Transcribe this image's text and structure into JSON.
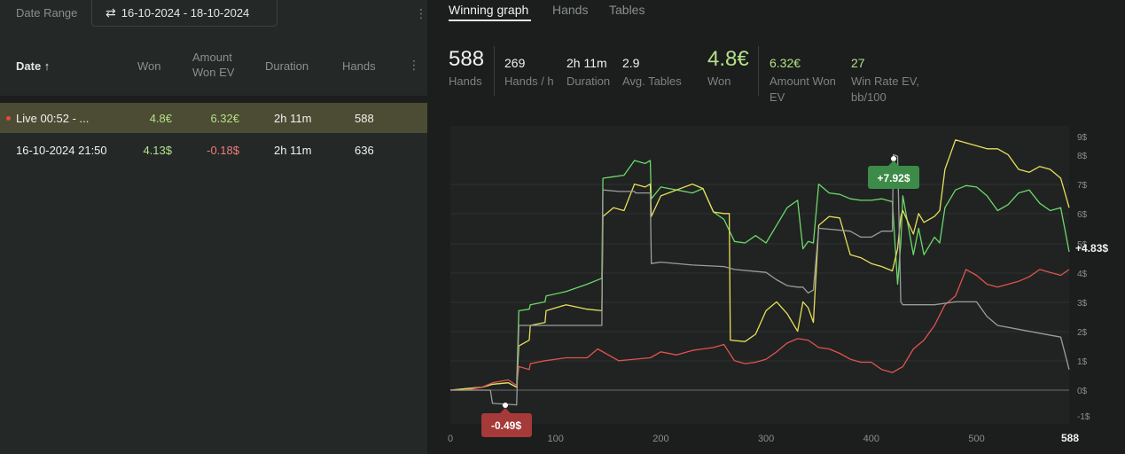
{
  "filter": {
    "date_range_label": "Date Range",
    "date_range_value": "16-10-2024 - 18-10-2024",
    "swap_icon": "⇄"
  },
  "table": {
    "headers": {
      "date": "Date ↑",
      "won": "Won",
      "ev_line1": "Amount",
      "ev_line2": "Won EV",
      "duration": "Duration",
      "hands": "Hands"
    },
    "rows": [
      {
        "date": "Live 00:52 - ...",
        "won": "4.8€",
        "ev": "6.32€",
        "duration": "2h 11m",
        "hands": "588",
        "live": true
      },
      {
        "date": "16-10-2024 21:50",
        "won": "4.13$",
        "ev": "-0.18$",
        "duration": "2h 11m",
        "hands": "636",
        "live": false
      }
    ]
  },
  "tabs": [
    "Winning graph",
    "Hands",
    "Tables"
  ],
  "stats": {
    "hands_value": "588",
    "hands_label": "Hands",
    "hph_value": "269",
    "hph_label": "Hands / h",
    "duration_value": "2h 11m",
    "duration_label": "Duration",
    "tables_value": "2.9",
    "tables_label": "Avg. Tables",
    "won_value": "4.8€",
    "won_label": "Won",
    "ev_value": "6.32€",
    "ev_label_1": "Amount Won",
    "ev_label_2": "EV",
    "winrate_value": "27",
    "winrate_label_1": "Win Rate EV,",
    "winrate_label_2": "bb/100"
  },
  "chart_data": {
    "type": "line",
    "x_ticks": [
      "0",
      "100",
      "200",
      "300",
      "400",
      "500"
    ],
    "x_max_label": "588",
    "xlim": [
      0,
      588
    ],
    "y_ticks": [
      "9$",
      "8$",
      "7$",
      "6$",
      "5$",
      "4$",
      "3$",
      "2$",
      "1$",
      "0$",
      "-1$"
    ],
    "ylim": [
      -1,
      9
    ],
    "annotations": {
      "max_label": "+7.92$",
      "min_label": "-0.49$",
      "end_label": "+4.83$"
    },
    "colors": {
      "green": "#6cd86a",
      "yellow": "#e8de5c",
      "red": "#e0534f",
      "gray": "#9a9d9b"
    },
    "series": [
      {
        "color": "green",
        "x": [
          0,
          15,
          30,
          40,
          55,
          63,
          65,
          75,
          76,
          90,
          91,
          110,
          130,
          144,
          145,
          155,
          165,
          175,
          185,
          190,
          191,
          200,
          215,
          230,
          240,
          250,
          260,
          270,
          280,
          290,
          300,
          310,
          320,
          330,
          335,
          340,
          345,
          350,
          360,
          370,
          380,
          390,
          400,
          410,
          420,
          425,
          428,
          430,
          440,
          445,
          450,
          460,
          465,
          470,
          480,
          490,
          500,
          510,
          520,
          530,
          540,
          550,
          560,
          570,
          580,
          588
        ],
        "y": [
          0.0,
          0.05,
          0.1,
          0.2,
          0.25,
          0.1,
          2.7,
          2.75,
          2.9,
          3.0,
          3.2,
          3.35,
          3.6,
          3.8,
          7.2,
          7.25,
          7.3,
          7.8,
          7.7,
          7.8,
          6.5,
          6.9,
          6.8,
          6.7,
          6.85,
          6.05,
          5.8,
          5.05,
          5.0,
          5.25,
          5.0,
          5.6,
          6.2,
          6.45,
          4.8,
          5.05,
          5.0,
          7.0,
          6.7,
          6.65,
          6.5,
          6.45,
          6.45,
          6.5,
          6.4,
          3.6,
          5.0,
          6.6,
          4.6,
          5.5,
          4.6,
          5.2,
          5.0,
          6.2,
          6.8,
          6.95,
          6.9,
          6.6,
          6.1,
          6.3,
          6.7,
          6.8,
          6.35,
          6.1,
          6.2,
          4.7
        ]
      },
      {
        "color": "yellow",
        "x": [
          0,
          15,
          30,
          40,
          55,
          63,
          65,
          75,
          76,
          90,
          91,
          110,
          130,
          144,
          145,
          155,
          165,
          175,
          185,
          190,
          191,
          200,
          215,
          230,
          240,
          250,
          260,
          265,
          266,
          280,
          290,
          300,
          310,
          320,
          330,
          335,
          340,
          345,
          350,
          360,
          370,
          380,
          390,
          400,
          410,
          420,
          425,
          428,
          430,
          440,
          445,
          450,
          460,
          465,
          470,
          480,
          490,
          500,
          510,
          520,
          530,
          540,
          550,
          560,
          570,
          580,
          588
        ],
        "y": [
          0.0,
          0.05,
          0.1,
          0.2,
          0.25,
          0.1,
          1.5,
          1.7,
          2.2,
          2.3,
          2.7,
          2.9,
          2.75,
          2.7,
          5.9,
          6.2,
          6.1,
          7.0,
          6.9,
          7.0,
          5.9,
          6.6,
          6.8,
          7.0,
          6.85,
          6.05,
          6.0,
          6.0,
          1.7,
          1.65,
          1.9,
          2.7,
          3.0,
          2.6,
          2.0,
          3.0,
          2.8,
          2.3,
          5.6,
          5.9,
          5.85,
          4.6,
          4.5,
          4.3,
          4.2,
          4.05,
          4.8,
          5.9,
          6.1,
          5.3,
          6.0,
          5.7,
          5.9,
          6.1,
          7.5,
          8.5,
          8.4,
          8.3,
          8.2,
          8.2,
          8.0,
          7.5,
          7.4,
          7.6,
          7.5,
          7.2,
          6.2
        ]
      },
      {
        "color": "red",
        "x": [
          0,
          15,
          30,
          40,
          55,
          63,
          65,
          75,
          76,
          90,
          110,
          130,
          140,
          160,
          175,
          190,
          200,
          215,
          230,
          240,
          250,
          260,
          270,
          280,
          290,
          300,
          310,
          320,
          330,
          340,
          350,
          360,
          370,
          380,
          390,
          400,
          410,
          420,
          430,
          440,
          450,
          460,
          470,
          480,
          490,
          500,
          510,
          520,
          530,
          540,
          550,
          560,
          570,
          580,
          588
        ],
        "y": [
          0.0,
          0.0,
          0.1,
          0.25,
          0.35,
          0.15,
          0.8,
          0.7,
          0.9,
          1.0,
          1.1,
          1.1,
          1.4,
          1.0,
          1.05,
          1.1,
          1.3,
          1.2,
          1.35,
          1.4,
          1.45,
          1.55,
          1.0,
          0.9,
          0.95,
          1.05,
          1.3,
          1.6,
          1.75,
          1.7,
          1.45,
          1.4,
          1.25,
          1.05,
          0.95,
          0.95,
          0.7,
          0.6,
          0.8,
          1.4,
          1.7,
          2.2,
          2.9,
          3.2,
          4.1,
          3.9,
          3.6,
          3.5,
          3.6,
          3.7,
          3.85,
          4.1,
          4.0,
          3.9,
          4.1
        ]
      },
      {
        "color": "gray",
        "x": [
          0,
          38,
          40,
          63,
          65,
          144,
          145,
          160,
          175,
          176,
          190,
          191,
          200,
          230,
          260,
          270,
          300,
          310,
          320,
          330,
          335,
          340,
          345,
          350,
          380,
          390,
          400,
          410,
          420,
          421,
          425,
          428,
          430,
          450,
          460,
          480,
          500,
          510,
          520,
          580,
          588
        ],
        "y": [
          0.0,
          0.0,
          -0.45,
          -0.5,
          2.2,
          2.2,
          6.8,
          6.75,
          6.75,
          6.7,
          6.7,
          4.3,
          4.35,
          4.25,
          4.2,
          4.1,
          4.0,
          3.75,
          3.55,
          3.5,
          3.5,
          3.3,
          3.4,
          5.5,
          5.4,
          5.2,
          5.2,
          5.4,
          5.4,
          8.0,
          7.95,
          3.0,
          2.9,
          2.9,
          2.9,
          3.0,
          3.0,
          2.5,
          2.2,
          1.8,
          0.7
        ]
      }
    ]
  }
}
